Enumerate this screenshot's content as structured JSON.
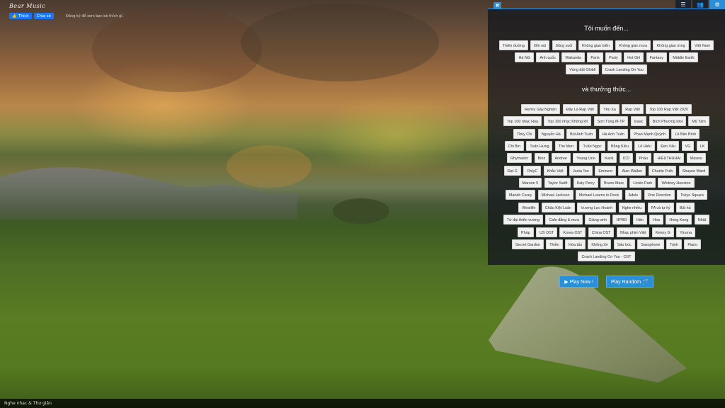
{
  "site": {
    "title": "Bear Music",
    "like_label": "Thích",
    "share_label": "Chia sẻ",
    "fb_note": "Đăng ký để xem bạn bè thích gì."
  },
  "topbar": {
    "icons": [
      "list-icon",
      "users-icon",
      "settings-icon"
    ]
  },
  "panel": {
    "heading_places": "Tôi muốn đến...",
    "heading_music": "và thưởng thức...",
    "places": [
      "Thiên đường",
      "Đồi núi",
      "Sông suối",
      "Không gian biển",
      "Không gian mưa",
      "Không gian rừng",
      "Việt Nam",
      "Hà Nội",
      "Anh quốc",
      "Wakanda",
      "Paris",
      "Party",
      "Hot Girl",
      "Fantasy",
      "Middle Earth",
      "Vùng đất Ghibli",
      "Crash Landing On You"
    ],
    "music": [
      "Remix Gây Nghiện",
      "Đây Là Rap Việt",
      "Yêu Xa",
      "Rap Việt",
      "Top 100 Rap Việt 2020",
      "Top 100 nhạc Hoa",
      "Top 100 nhạc Không lời",
      "Sơn Tùng M-TP",
      "Isaac",
      "Bích Phương Idol",
      "Mỹ Tâm",
      "Thùy Chi",
      "Nguyên Hà",
      "Bùi Anh Tuấn",
      "Hà Anh Tuấn",
      "Phan Mạnh Quỳnh",
      "Lê Bảo Bình",
      "Chi Bin",
      "Tuấn Hưng",
      "The Men",
      "Tuấn Ngọc",
      "Bằng Kiều",
      "Lê Hiếu",
      "Đen Vâu",
      "VG",
      "LK",
      "Rhymastic",
      "Binz",
      "Andree",
      "Young Uno",
      "Karik",
      "ICD",
      "Pháo",
      "HIEUTHUHAI",
      "Masew",
      "Đạt G",
      "OnlyC",
      "Khắc Việt",
      "Justa Tee",
      "Eminem",
      "Alan Walker",
      "Charlie Puth",
      "Shayne Ward",
      "Maroon 5",
      "Taylor Swift",
      "Katy Perry",
      "Bruno Mars",
      "Linkin Park",
      "Whitney Houston",
      "Mariah Carey",
      "Michael Jackson",
      "Michael Learns to Rock",
      "Adele",
      "One Direction",
      "Tokyo Square",
      "Westlife",
      "Châu Kiệt Luân",
      "Vương Lực Hoành",
      "Nghe nhiều",
      "FA và tự kỷ",
      "Bất hủ",
      "Tứ đại thiên vương",
      "Cafe đắng & mưa",
      "Giáng sinh",
      "HPBD",
      "Hàn",
      "Hoa",
      "Hong Kong",
      "Nhật",
      "Pháp",
      "US OST",
      "Korea OST",
      "China OST",
      "Nhạc phim Việt",
      "Kenny G",
      "Yiruma",
      "Secret Garden",
      "Thiền",
      "Hòa tấu",
      "Không lời",
      "Sáo trúc",
      "Saxophone",
      "Trịnh",
      "Piano",
      "Crash Landing On You - OST"
    ],
    "play_now": "▶ Play Now !",
    "play_random": "Play Random 🪄"
  },
  "footer": {
    "text": "Nghe nhạc & Thư giãn"
  }
}
